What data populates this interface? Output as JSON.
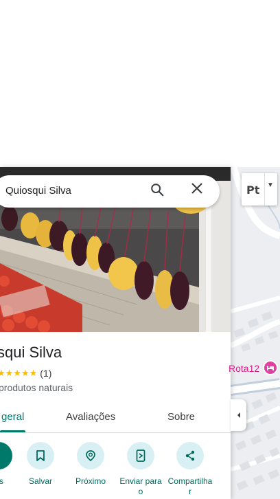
{
  "search": {
    "query": "Quiosqui Silva"
  },
  "place": {
    "title": "squi Silva",
    "stars": "★★★★★",
    "rating_count": "(1)",
    "category": "produtos naturais"
  },
  "tabs": [
    {
      "label": "geral",
      "active": true
    },
    {
      "label": "Avaliações"
    },
    {
      "label": "Sobre"
    }
  ],
  "actions": [
    {
      "label": "s",
      "icon": "directions-icon"
    },
    {
      "label": "Salvar",
      "icon": "bookmark-icon"
    },
    {
      "label": "Próximo",
      "icon": "nearby-icon"
    },
    {
      "label": "Enviar para o",
      "icon": "send-to-phone-icon"
    },
    {
      "label": "Compartilha r",
      "icon": "share-icon"
    }
  ],
  "map": {
    "poi_label": "Rota12",
    "layer_button_label": "Pt"
  },
  "colors": {
    "accent": "#00796b",
    "action_circle": "#d8f0f3",
    "star": "#fbbc04",
    "poi": "#d81b86"
  }
}
